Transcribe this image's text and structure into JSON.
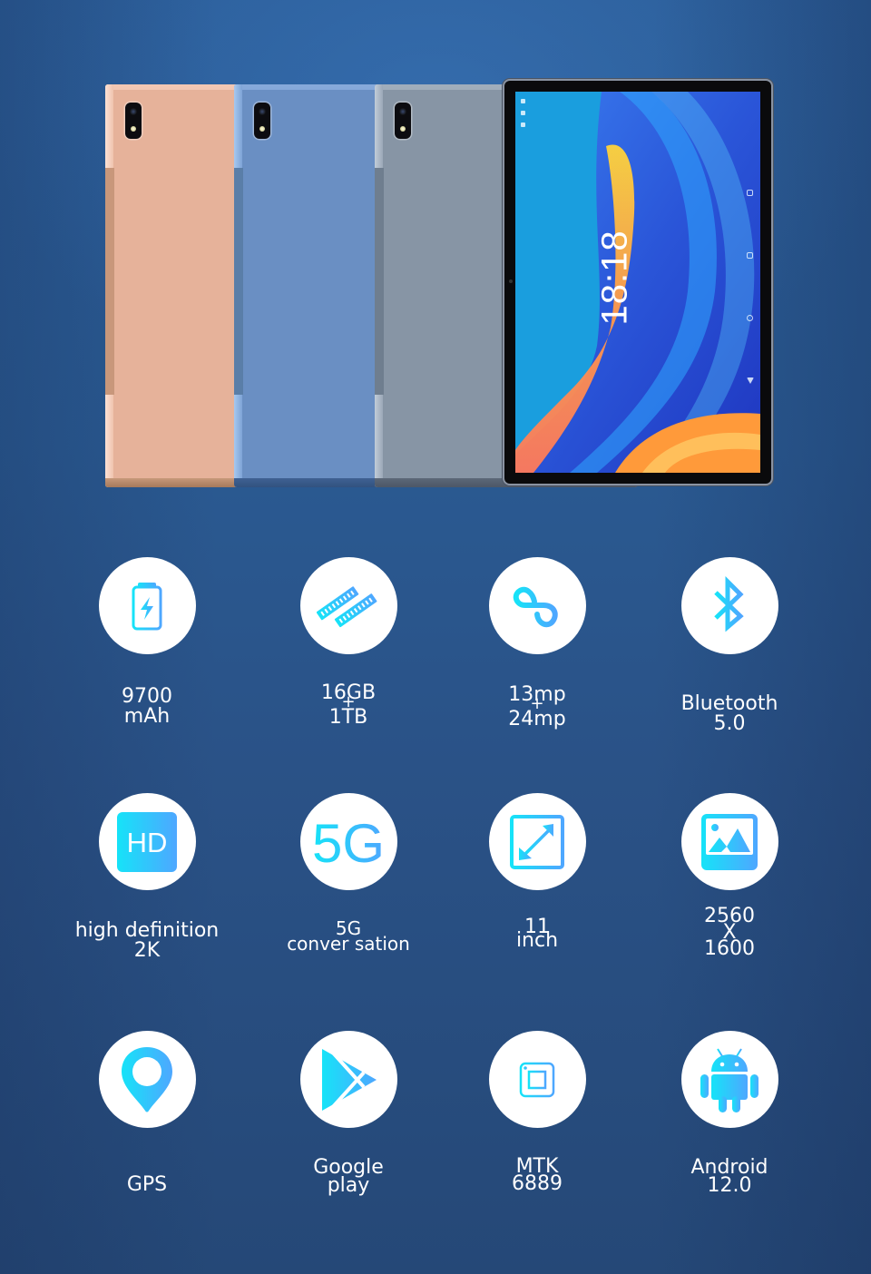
{
  "hero": {
    "product_colors": [
      {
        "name": "rose-gold",
        "hex": "#e6b29a"
      },
      {
        "name": "blue",
        "hex": "#6a8fc3"
      },
      {
        "name": "gray",
        "hex": "#8795a5"
      }
    ],
    "lockscreen_time": "18:18"
  },
  "theme": {
    "background": "#2a5a92",
    "icon_gradient_start": "#16e3f8",
    "icon_gradient_end": "#4ea7ff",
    "icon_circle": "#ffffff",
    "label_color": "#ffffff"
  },
  "features": [
    {
      "id": "battery",
      "icon": "battery-charging-icon",
      "line1": "9700",
      "line2": "mAh"
    },
    {
      "id": "memory",
      "icon": "ram-stick-icon",
      "line1": "16GB",
      "plus": "+",
      "line2": "1TB"
    },
    {
      "id": "camera",
      "icon": "infinity-loop-icon",
      "line1": "13mp",
      "plus": "+",
      "line2": "24mp"
    },
    {
      "id": "bluetooth",
      "icon": "bluetooth-icon",
      "line1": "Bluetooth",
      "line2": "5.0"
    },
    {
      "id": "display",
      "icon": "hd-icon",
      "icon_text": "HD",
      "line1": "high definition",
      "line2": "2K"
    },
    {
      "id": "network",
      "icon": "5g-icon",
      "icon_text": "5G",
      "line1": "5G",
      "line2": "conver sation"
    },
    {
      "id": "size",
      "icon": "screen-size-icon",
      "line1": "11",
      "line2": "inch"
    },
    {
      "id": "resolution",
      "icon": "image-icon",
      "line1": "2560",
      "plus": "X",
      "line2": "1600"
    },
    {
      "id": "gps",
      "icon": "location-pin-icon",
      "line1": "GPS"
    },
    {
      "id": "store",
      "icon": "google-play-icon",
      "line1": "Google",
      "line2": "play"
    },
    {
      "id": "cpu",
      "icon": "processor-chip-icon",
      "line1": "MTK",
      "line2": "6889"
    },
    {
      "id": "os",
      "icon": "android-icon",
      "line1": "Android",
      "line2": "12.0"
    }
  ]
}
